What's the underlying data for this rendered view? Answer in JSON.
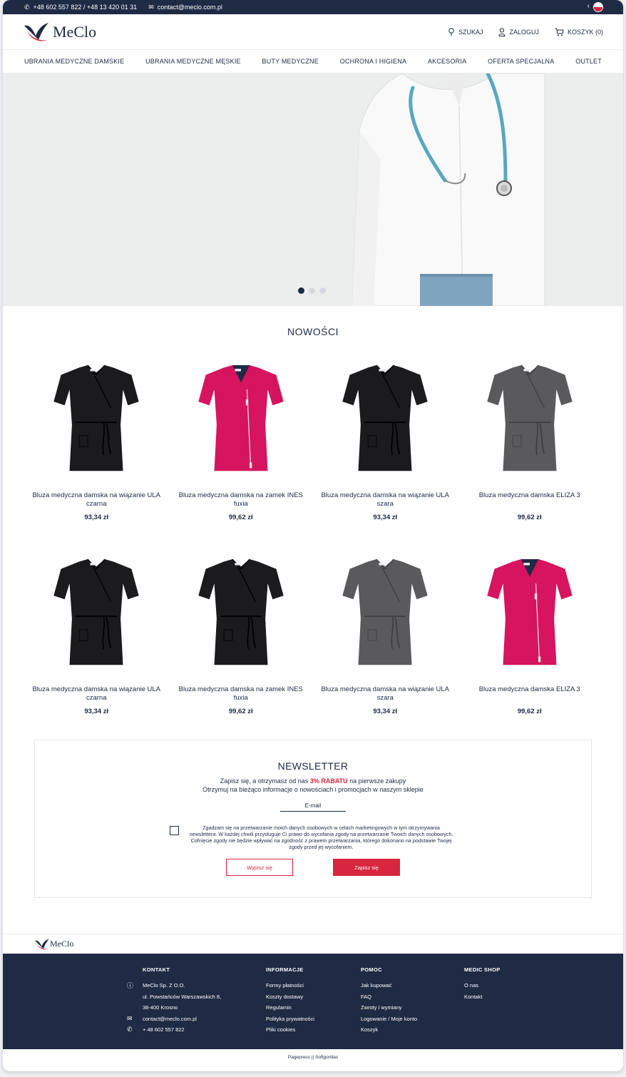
{
  "topbar": {
    "phones": "+48 602 557 822 / +48 13 420 01 31",
    "email": "contact@meclo.com.pl"
  },
  "header": {
    "logo": "MeClo",
    "search": "SZUKAJ",
    "login": "ZALOGUJ",
    "cart": "KOSZYK (0)"
  },
  "nav": [
    "UBRANIA MEDYCZNE DAMSKIE",
    "UBRANIA MEDYCZNE MĘSKIE",
    "BUTY MEDYCZNE",
    "OCHRONA I HIGIENA",
    "AKCESORIA",
    "OFERTA SPECJALNA",
    "OUTLET"
  ],
  "slider": {
    "slides": 3,
    "active": 1
  },
  "news": {
    "title": "NOWOŚCI",
    "products": [
      {
        "name": "Bluza medyczna damska na wiązanie ULA czarna",
        "price": "93,34 zł",
        "color": "#1b1b1d",
        "style": "wrap"
      },
      {
        "name": "Bluza medyczna damska na zamek INES fuxia",
        "price": "99,62 zł",
        "color": "#d6145f",
        "style": "zip"
      },
      {
        "name": "Bluza medyczna damska na wiązanie ULA szara",
        "price": "93,34 zł",
        "color": "#1b1b1d",
        "style": "wrap"
      },
      {
        "name": "Bluza medyczna damska ELIZA 3",
        "price": "99,62 zł",
        "color": "#5a5a5c",
        "style": "wrap"
      },
      {
        "name": "Bluza medyczna damska na wiązanie ULA czarna",
        "price": "93,34 zł",
        "color": "#1b1b1d",
        "style": "wrap"
      },
      {
        "name": "Bluza medyczna damska na zamek INES fuxia",
        "price": "99,62 zł",
        "color": "#1b1b1d",
        "style": "wrap"
      },
      {
        "name": "Bluza medyczna damska na wiązanie ULA szara",
        "price": "93,34 zł",
        "color": "#5a5a5c",
        "style": "wrap"
      },
      {
        "name": "Bluza medyczna damska ELIZA 3",
        "price": "99,62 zł",
        "color": "#d6145f",
        "style": "zip"
      }
    ]
  },
  "newsletter": {
    "title": "NEWSLETTER",
    "line1_pre": "Zapisz się, a otrzymasz od nas ",
    "line1_highlight": "3% RABATU",
    "line1_post": " na pierwsze zakupy",
    "line2": "Otrzymuj na bieżąco informacje o nowościach i promocjach w naszym sklepie",
    "email_placeholder": "E-mail",
    "consent": "Zgadzam się na przetwarzanie moich danych osobowych w celach marketingowych w tym otrzymywania newslettera. W każdej chwili przysługuje Ci prawo do wycofania zgody na przetwarzanie Twoich danych osobowych. Cofnięcie zgody nie będzie wpływać na zgodność z prawem przetwarzania, którego dokonano na podstawie Twojej zgody przed jej wycofaniem.",
    "unsubscribe": "Wypisz się",
    "subscribe": "Zapisz się"
  },
  "footer": {
    "logo": "MeClo",
    "kontakt": {
      "title": "KONTAKT",
      "company": "MeClo Sp. Z O.O.",
      "street": "ul. Powstańców Warszawskich 8,",
      "city": "38-400 Krosno",
      "email": "contact@meclo.com.pl",
      "phone": "+ 48 602 557 822"
    },
    "informacje": {
      "title": "INFORMACJE",
      "links": [
        "Formy płatności",
        "Koszty dostawy",
        "Regulamin",
        "Polityka prywatności",
        "Pliki cookies"
      ]
    },
    "pomoc": {
      "title": "POMOC",
      "links": [
        "Jak kupować",
        "FAQ",
        "Zwroty i wymiany",
        "Logowanie / Moje konto",
        "Koszyk"
      ]
    },
    "medic": {
      "title": "MEDIC SHOP",
      "links": [
        "O nas",
        "Kontakt"
      ]
    },
    "credits": "Pagepress || Softgorillas"
  },
  "colors": {
    "navy": "#1f2a44",
    "red": "#d7263d",
    "fuchsia": "#d6145f"
  }
}
